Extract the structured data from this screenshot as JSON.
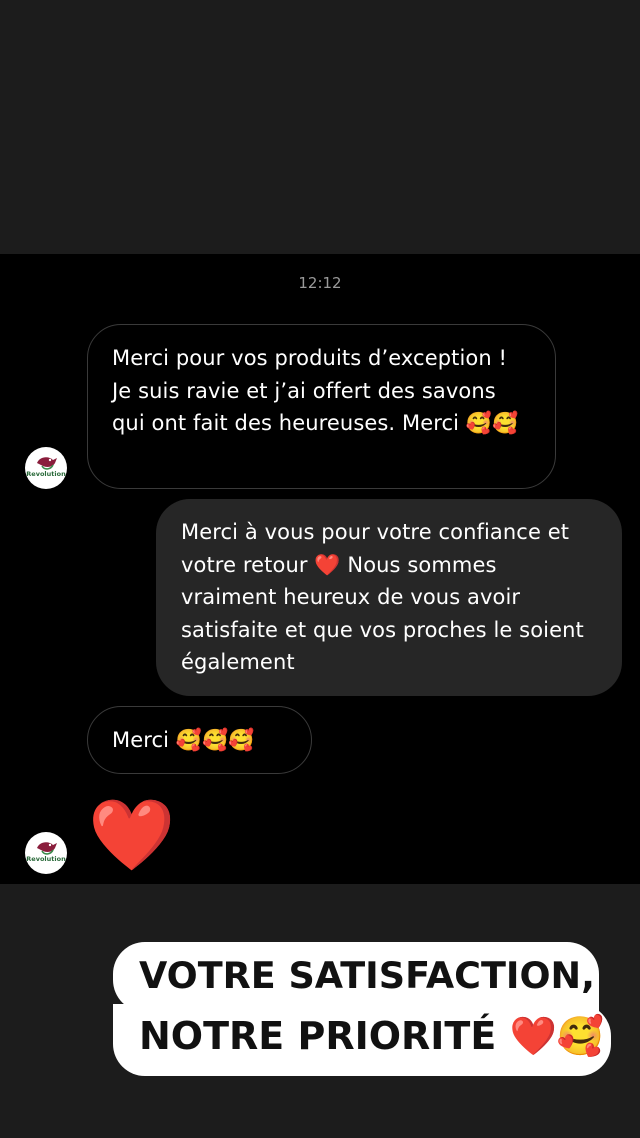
{
  "conversation": {
    "timestamp": "12:12",
    "messages": [
      {
        "sender": "customer",
        "text": "Merci pour vos produits d’exception ! Je suis ravie et j’ai offert des savons qui ont fait des heureuses. Merci 🥰🥰"
      },
      {
        "sender": "shop",
        "text": "Merci à vous pour votre confiance et votre retour ❤️ Nous sommes vraiment heureux de vous avoir satisfaite et que vos proches le soient également"
      },
      {
        "sender": "customer",
        "text": "Merci 🥰🥰🥰"
      },
      {
        "sender": "customer",
        "text": "❤️"
      }
    ],
    "avatar_logo_text": "Revolution"
  },
  "caption": {
    "line1": "VOTRE SATISFACTION,",
    "line2_text": "NOTRE PRIORITÉ",
    "line2_emoji": "❤️🥰"
  },
  "colors": {
    "background": "#000000",
    "outer_band": "#1c1c1c",
    "outgoing_bubble": "#262626",
    "incoming_border": "#3a3a3a",
    "heart": "#e0201b"
  }
}
